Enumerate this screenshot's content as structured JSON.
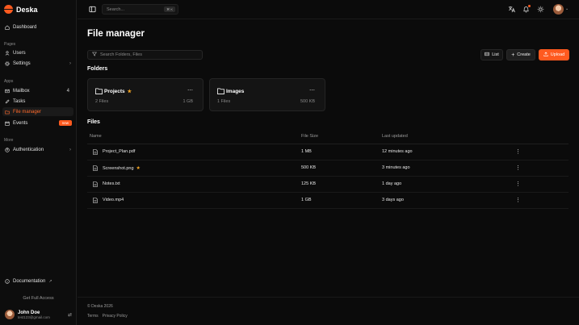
{
  "app": {
    "name": "Deska",
    "accent": "#ff5a1f"
  },
  "sidebar": {
    "dashboard": "Dashboard",
    "groups": {
      "pages": "Pages",
      "apps": "Apps",
      "more": "More"
    },
    "users": "Users",
    "settings": "Settings",
    "mailbox": "Mailbox",
    "mailbox_count": "4",
    "tasks": "Tasks",
    "file_manager": "File manager",
    "events": "Events",
    "events_badge": "new",
    "authentication": "Authentication",
    "documentation": "Documentation",
    "full_access": "Get Full Access",
    "user": {
      "name": "John Doe",
      "email": "test123@gmail.com"
    }
  },
  "topbar": {
    "search_placeholder": "Search...",
    "shortcut": "⌘ K"
  },
  "page": {
    "title": "File manager",
    "filter_placeholder": "Search Folders, Files",
    "buttons": {
      "list": "List",
      "create": "Create",
      "upload": "Upload"
    },
    "folders_title": "Folders",
    "files_title": "Files"
  },
  "folders": [
    {
      "name": "Projects",
      "starred": true,
      "count": "2 Files",
      "size": "1 GB"
    },
    {
      "name": "Images",
      "starred": false,
      "count": "1 Files",
      "size": "500 KB"
    }
  ],
  "files_table": {
    "headers": {
      "name": "Name",
      "size": "File Size",
      "updated": "Last updated"
    },
    "rows": [
      {
        "name": "Project_Plan.pdf",
        "starred": false,
        "size": "1 MB",
        "updated": "12 minutes ago"
      },
      {
        "name": "Screenshot.png",
        "starred": true,
        "size": "500 KB",
        "updated": "3 minutes ago"
      },
      {
        "name": "Notes.txt",
        "starred": false,
        "size": "125 KB",
        "updated": "1 day ago"
      },
      {
        "name": "Video.mp4",
        "starred": false,
        "size": "1 GB",
        "updated": "3 days ago"
      }
    ]
  },
  "footer": {
    "copyright": "© Deska 2026",
    "terms": "Terms",
    "privacy": "Privacy Policy"
  }
}
